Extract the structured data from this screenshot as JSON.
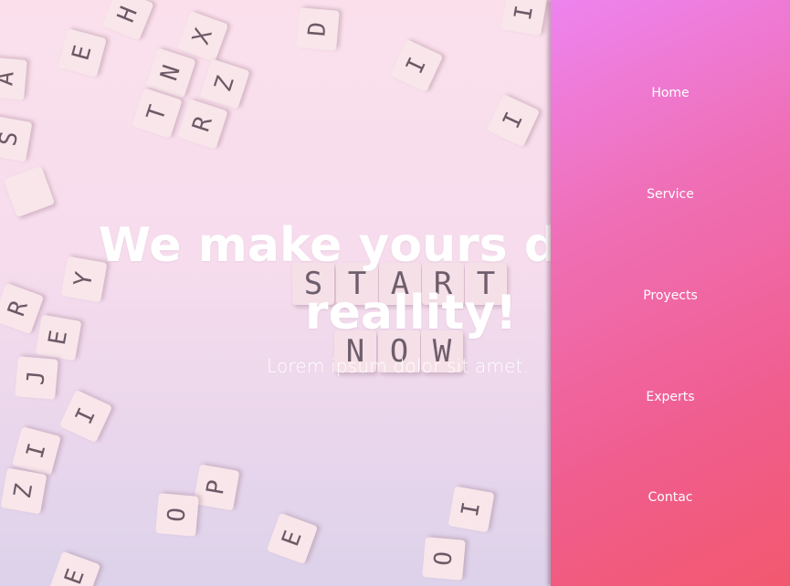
{
  "hero": {
    "title_line1": "We make yours dreams",
    "title_line2": "reallity!",
    "subtitle": "Lorem ipsum dolor sit amet."
  },
  "nav": {
    "items": [
      {
        "label": "Home"
      },
      {
        "label": "Service"
      },
      {
        "label": "Proyects"
      },
      {
        "label": "Experts"
      },
      {
        "label": "Contac"
      }
    ]
  },
  "background_tiles": {
    "start_word": [
      "S",
      "T",
      "A",
      "R",
      "T"
    ],
    "now_word": [
      "N",
      "O",
      "W"
    ],
    "scattered": [
      "H",
      "E",
      "X",
      "N",
      "Z",
      "T",
      "R",
      "D",
      "I",
      "I",
      "I",
      "Y",
      "R",
      "E",
      "J",
      "I",
      "I",
      "Z",
      "P",
      "O",
      "E",
      "O",
      "I",
      "E",
      "S",
      "A"
    ]
  },
  "colors": {
    "nav_gradient_start": "#ee84f0",
    "nav_gradient_end": "#f2586e",
    "hero_background": "#f8dfec",
    "text": "#ffffff"
  }
}
